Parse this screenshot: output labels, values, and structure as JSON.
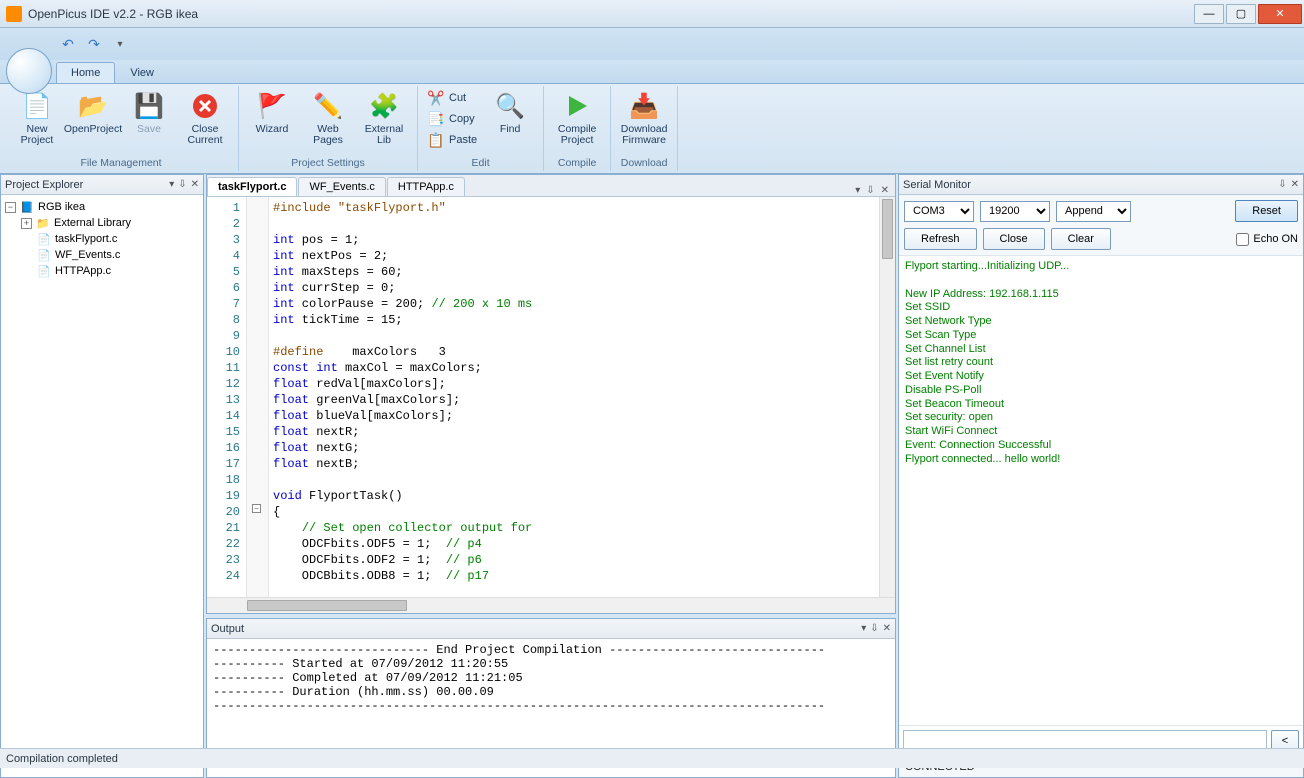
{
  "window": {
    "title": "OpenPicus IDE v2.2 - RGB ikea"
  },
  "ribbon": {
    "tabs": {
      "home": "Home",
      "view": "View"
    },
    "file_mgmt": {
      "title": "File Management",
      "new_project": "New\nProject",
      "open_project": "OpenProject",
      "save": "Save",
      "close_current": "Close\nCurrent"
    },
    "project_settings": {
      "title": "Project Settings",
      "wizard": "Wizard",
      "web_pages": "Web\nPages",
      "external_lib": "External\nLib"
    },
    "edit": {
      "title": "Edit",
      "cut": "Cut",
      "copy": "Copy",
      "paste": "Paste",
      "find": "Find"
    },
    "compile": {
      "title": "Compile",
      "compile_project": "Compile\nProject"
    },
    "download": {
      "title": "Download",
      "download_firmware": "Download\nFirmware"
    }
  },
  "project_explorer": {
    "title": "Project Explorer",
    "root": "RGB ikea",
    "ext_lib": "External Library",
    "files": [
      "taskFlyport.c",
      "WF_Events.c",
      "HTTPApp.c"
    ]
  },
  "editor": {
    "tabs": [
      "taskFlyport.c",
      "WF_Events.c",
      "HTTPApp.c"
    ],
    "lines": [
      {
        "n": 1,
        "html": "<span class='pp'>#include</span> <span class='str'>\"taskFlyport.h\"</span>"
      },
      {
        "n": 2,
        "html": ""
      },
      {
        "n": 3,
        "html": "<span class='kw'>int</span> pos = 1;"
      },
      {
        "n": 4,
        "html": "<span class='kw'>int</span> nextPos = 2;"
      },
      {
        "n": 5,
        "html": "<span class='kw'>int</span> maxSteps = 60;"
      },
      {
        "n": 6,
        "html": "<span class='kw'>int</span> currStep = 0;"
      },
      {
        "n": 7,
        "html": "<span class='kw'>int</span> colorPause = 200; <span class='cm'>// 200 x 10 ms</span>"
      },
      {
        "n": 8,
        "html": "<span class='kw'>int</span> tickTime = 15;"
      },
      {
        "n": 9,
        "html": ""
      },
      {
        "n": 10,
        "html": "<span class='pp'>#define</span>    maxColors   3"
      },
      {
        "n": 11,
        "html": "<span class='kw'>const</span> <span class='kw'>int</span> maxCol = maxColors;"
      },
      {
        "n": 12,
        "html": "<span class='kw'>float</span> redVal[maxColors];"
      },
      {
        "n": 13,
        "html": "<span class='kw'>float</span> greenVal[maxColors];"
      },
      {
        "n": 14,
        "html": "<span class='kw'>float</span> blueVal[maxColors];"
      },
      {
        "n": 15,
        "html": "<span class='kw'>float</span> nextR;"
      },
      {
        "n": 16,
        "html": "<span class='kw'>float</span> nextG;"
      },
      {
        "n": 17,
        "html": "<span class='kw'>float</span> nextB;"
      },
      {
        "n": 18,
        "html": ""
      },
      {
        "n": 19,
        "html": "<span class='kw'>void</span> FlyportTask()"
      },
      {
        "n": 20,
        "html": "{"
      },
      {
        "n": 21,
        "html": "    <span class='cm'>// Set open collector output for</span>"
      },
      {
        "n": 22,
        "html": "    ODCFbits.ODF5 = 1;  <span class='cm'>// p4</span>"
      },
      {
        "n": 23,
        "html": "    ODCFbits.ODF2 = 1;  <span class='cm'>// p6</span>"
      },
      {
        "n": 24,
        "html": "    ODCBbits.ODB8 = 1;  <span class='cm'>// p17</span>"
      }
    ]
  },
  "output": {
    "title": "Output",
    "text": "------------------------------ End Project Compilation ------------------------------\n---------- Started at 07/09/2012 11:20:55\n---------- Completed at 07/09/2012 11:21:05\n---------- Duration (hh.mm.ss) 00.00.09\n-------------------------------------------------------------------------------------"
  },
  "serial": {
    "title": "Serial Monitor",
    "port": "COM3",
    "baud": "19200",
    "mode": "Append",
    "reset": "Reset",
    "refresh": "Refresh",
    "close": "Close",
    "clear": "Clear",
    "echo": "Echo ON",
    "status": "CONNECTED",
    "send_icon": "<",
    "log": [
      "Flyport starting...Initializing UDP...",
      "",
      "New IP Address: 192.168.1.115",
      "Set SSID",
      "Set Network Type",
      "Set Scan Type",
      "Set Channel List",
      "Set list retry count",
      "Set Event Notify",
      "Disable PS-Poll",
      "Set Beacon Timeout",
      "Set security: open",
      "Start WiFi Connect",
      "Event: Connection Successful",
      "Flyport connected... hello world!"
    ]
  },
  "statusbar": {
    "text": "Compilation completed"
  }
}
